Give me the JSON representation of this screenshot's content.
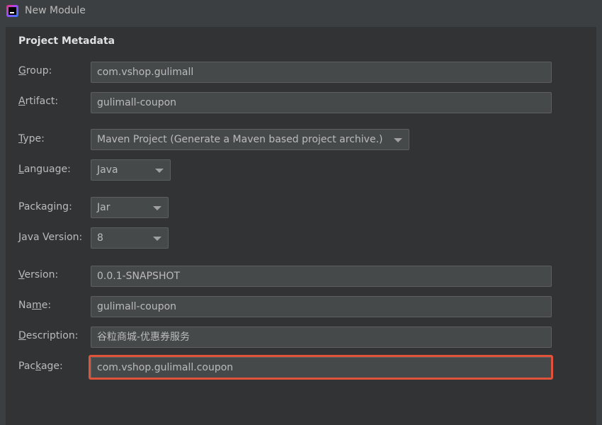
{
  "window": {
    "title": "New Module"
  },
  "section": {
    "title": "Project Metadata"
  },
  "fields": {
    "group": {
      "label_mnemonic": "G",
      "label_rest": "roup:",
      "value": "com.vshop.gulimall"
    },
    "artifact": {
      "label_mnemonic": "A",
      "label_rest": "rtifact:",
      "value": "gulimall-coupon"
    },
    "type": {
      "label_mnemonic": "T",
      "label_rest": "ype:",
      "value": "Maven Project (Generate a Maven based project archive.)"
    },
    "language": {
      "label_mnemonic": "L",
      "label_rest": "anguage:",
      "value": "Java"
    },
    "packaging": {
      "label": "Packaging:",
      "value": "Jar"
    },
    "java_version": {
      "label_mnemonic": "J",
      "label_rest": "ava Version:",
      "value": "8"
    },
    "version": {
      "label_mnemonic": "V",
      "label_rest": "ersion:",
      "value": "0.0.1-SNAPSHOT"
    },
    "name": {
      "label_pre": "Na",
      "label_mnemonic": "m",
      "label_rest": "e:",
      "value": "gulimall-coupon"
    },
    "description": {
      "label_mnemonic": "D",
      "label_rest": "escription:",
      "value": "谷粒商城-优惠券服务"
    },
    "package": {
      "label_pre": "Pac",
      "label_mnemonic": "k",
      "label_rest": "age:",
      "value": "com.vshop.gulimall.coupon"
    }
  },
  "colors": {
    "background": "#3c3f41",
    "field_bg": "#45494a",
    "text": "#bbbbbb",
    "highlight_border": "#e0533a"
  },
  "icons": {
    "app": "intellij-idea-icon",
    "dropdown": "chevron-down-icon"
  }
}
